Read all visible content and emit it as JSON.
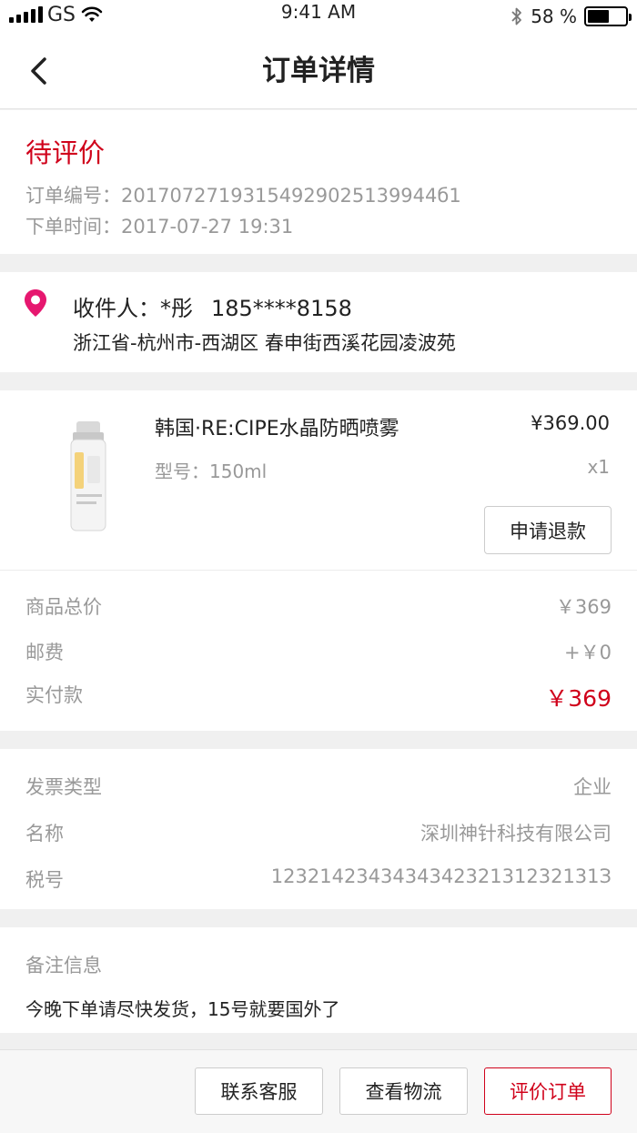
{
  "status_bar": {
    "carrier": "GS",
    "time": "9:41 AM",
    "battery_text": "58 %",
    "battery_level": 0.58
  },
  "nav": {
    "title": "订单详情"
  },
  "order": {
    "status": "待评价",
    "status_color": "#d0021b",
    "number_line": "订单编号：20170727193154929025139944б1",
    "time_line": "下单时间：2017-07-27 19:31"
  },
  "address": {
    "recipient": "收件人：*彤",
    "phone": "185****8158",
    "detail": "浙江省-杭州市-西湖区 春申街西溪花园凌波苑"
  },
  "goods": {
    "name": "韩国·RE:CIPE水晶防晒喷雾",
    "price": "¥369.00",
    "spec": "型号：150ml",
    "qty": "x1",
    "refund_label": "申请退款"
  },
  "summary": [
    {
      "label": "商品总价",
      "value": "￥369"
    },
    {
      "label": "邮费",
      "value": "+￥0"
    },
    {
      "label": "实付款",
      "value": "￥369"
    }
  ],
  "invoice": [
    {
      "label": "发票类型",
      "value": "企业"
    },
    {
      "label": "名称",
      "value": "深圳神针科技有限公司"
    },
    {
      "label": "税号",
      "value": "123214234343434232131232131З"
    }
  ],
  "remark": {
    "title": "备注信息",
    "text": "今晚下单请尽快发货，15号就要国外了"
  },
  "actions": {
    "contact": "联系客服",
    "logistics": "查看物流",
    "review": "评价订单"
  },
  "colors": {
    "accent": "#d0021b",
    "pin": "#e6176f"
  }
}
